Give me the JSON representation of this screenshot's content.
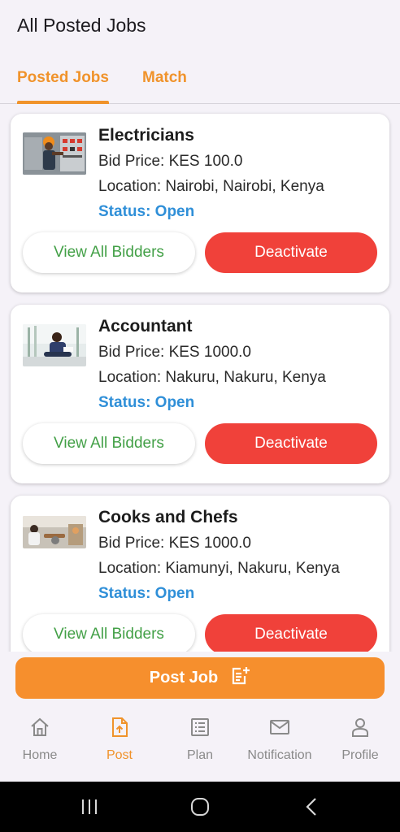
{
  "header": {
    "title": "All Posted Jobs",
    "tabs": [
      {
        "label": "Posted Jobs",
        "active": true
      },
      {
        "label": "Match",
        "active": false
      }
    ]
  },
  "jobs": [
    {
      "title": "Electricians",
      "bid": "Bid Price: KES 100.0",
      "location": "Location: Nairobi, Nairobi, Kenya",
      "status": "Status: Open",
      "view_label": "View All Bidders",
      "deactivate_label": "Deactivate"
    },
    {
      "title": "Accountant",
      "bid": "Bid Price: KES 1000.0",
      "location": "Location: Nakuru, Nakuru, Kenya",
      "status": "Status: Open",
      "view_label": "View All Bidders",
      "deactivate_label": "Deactivate"
    },
    {
      "title": "Cooks and Chefs",
      "bid": "Bid Price: KES 1000.0",
      "location": "Location: Kiamunyi, Nakuru, Kenya",
      "status": "Status: Open",
      "view_label": "View All Bidders",
      "deactivate_label": "Deactivate"
    }
  ],
  "post_job": {
    "label": "Post Job",
    "icon": "post-add-icon"
  },
  "nav": [
    {
      "label": "Home",
      "icon": "home-icon",
      "active": false
    },
    {
      "label": "Post",
      "icon": "post-icon",
      "active": true
    },
    {
      "label": "Plan",
      "icon": "plan-icon",
      "active": false
    },
    {
      "label": "Notification",
      "icon": "mail-icon",
      "active": false
    },
    {
      "label": "Profile",
      "icon": "person-icon",
      "active": false
    }
  ],
  "colors": {
    "accent": "#f0932b",
    "danger": "#f0413a",
    "status": "#2f8fd8",
    "success": "#43a047",
    "background": "#f5f2f8"
  }
}
